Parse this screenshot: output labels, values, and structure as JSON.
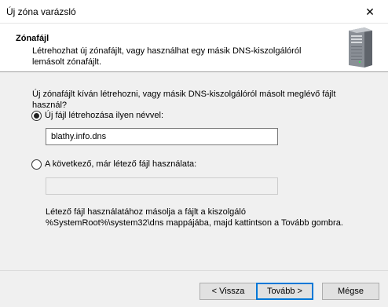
{
  "window": {
    "title": "Új zóna varázsló",
    "close_glyph": "✕"
  },
  "header": {
    "title": "Zónafájl",
    "subtitle": "Létrehozhat új zónafájlt, vagy használhat egy másik DNS-kiszolgálóról lemásolt zónafájlt.",
    "icon": "server-icon"
  },
  "body": {
    "question": "Új zónafájlt kíván létrehozni, vagy másik DNS-kiszolgálóról másolt meglévő fájlt használ?",
    "option_new": {
      "label": "Új fájl létrehozása ilyen névvel:",
      "selected": true,
      "value": "blathy.info.dns"
    },
    "option_existing": {
      "label": "A következő, már létező fájl használata:",
      "selected": false,
      "value": ""
    },
    "info": "Létező fájl használatához másolja a fájlt a kiszolgáló %SystemRoot%\\system32\\dns mappájába, majd kattintson a Tovább gombra."
  },
  "buttons": {
    "back": "< Vissza",
    "next": "Tovább >",
    "cancel": "Mégse"
  },
  "colors": {
    "accent": "#0078d7"
  }
}
